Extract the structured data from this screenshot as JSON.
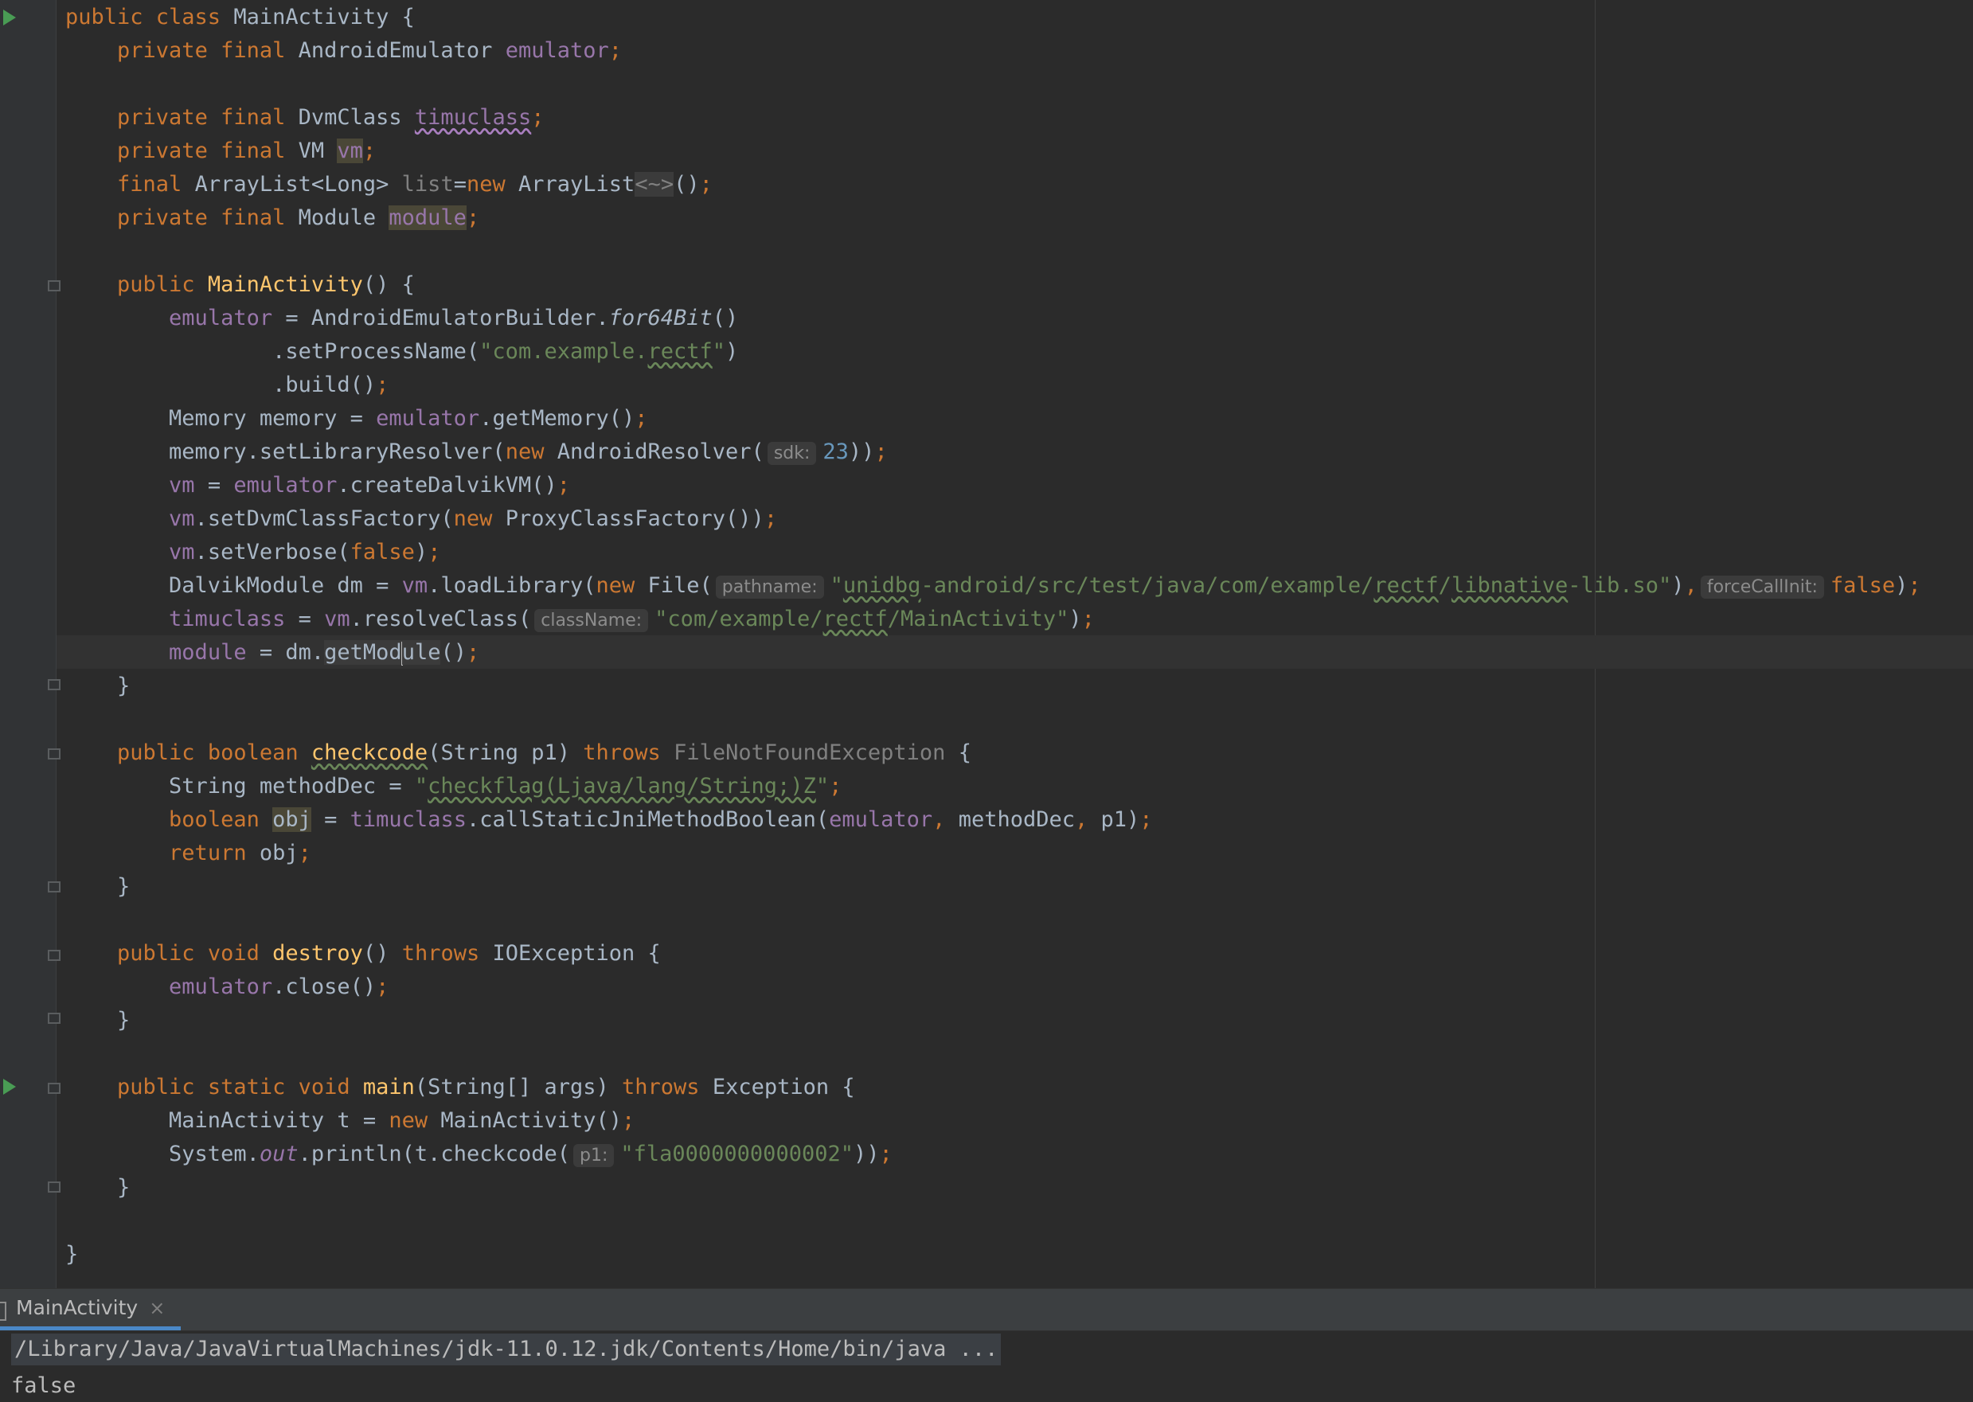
{
  "editor": {
    "lines": [
      [
        [
          "kw",
          "public class "
        ],
        [
          "",
          "MainActivity {"
        ]
      ],
      [
        [
          "",
          "    "
        ],
        [
          "kw",
          "private final "
        ],
        [
          "",
          "AndroidEmulator "
        ],
        [
          "fd",
          "emulator"
        ],
        [
          "kw",
          ";"
        ]
      ],
      [],
      [
        [
          "",
          "    "
        ],
        [
          "kw",
          "private final "
        ],
        [
          "",
          "DvmClass "
        ],
        [
          "fd sqp",
          "timuclass"
        ],
        [
          "kw",
          ";"
        ]
      ],
      [
        [
          "",
          "    "
        ],
        [
          "kw",
          "private final "
        ],
        [
          "",
          "VM "
        ],
        [
          "fd hl",
          "vm"
        ],
        [
          "kw",
          ";"
        ]
      ],
      [
        [
          "",
          "    "
        ],
        [
          "kw",
          "final "
        ],
        [
          "",
          "ArrayList<Long> "
        ],
        [
          "dim",
          "list"
        ],
        [
          "",
          "="
        ],
        [
          "kw",
          "new "
        ],
        [
          "",
          "ArrayList"
        ],
        [
          "dim hl2",
          "<~>"
        ],
        [
          "",
          "()"
        ],
        [
          "kw",
          ";"
        ]
      ],
      [
        [
          "",
          "    "
        ],
        [
          "kw",
          "private final "
        ],
        [
          "",
          "Module "
        ],
        [
          "fd hl",
          "module"
        ],
        [
          "kw",
          ";"
        ]
      ],
      [],
      [
        [
          "",
          "    "
        ],
        [
          "kw",
          "public "
        ],
        [
          "fn",
          "MainActivity"
        ],
        [
          "",
          "() {"
        ]
      ],
      [
        [
          "",
          "        "
        ],
        [
          "fd",
          "emulator"
        ],
        [
          "",
          " = AndroidEmulatorBuilder."
        ],
        [
          "it",
          "for64Bit"
        ],
        [
          "",
          "()"
        ]
      ],
      [
        [
          "",
          "                .setProcessName("
        ],
        [
          "st",
          "\"com.example."
        ],
        [
          "st sq",
          "rectf"
        ],
        [
          "st",
          "\""
        ],
        [
          "",
          ")"
        ]
      ],
      [
        [
          "",
          "                .build()"
        ],
        [
          "kw",
          ";"
        ]
      ],
      [
        [
          "",
          "        Memory memory = "
        ],
        [
          "fd",
          "emulator"
        ],
        [
          "",
          ".getMemory()"
        ],
        [
          "kw",
          ";"
        ]
      ],
      [
        [
          "",
          "        memory.setLibraryResolver("
        ],
        [
          "kw",
          "new "
        ],
        [
          "",
          "AndroidResolver("
        ],
        [
          "hint",
          "sdk:"
        ],
        [
          "nm",
          "23"
        ],
        [
          "",
          "))"
        ],
        [
          "kw",
          ";"
        ]
      ],
      [
        [
          "",
          "        "
        ],
        [
          "fd",
          "vm"
        ],
        [
          "",
          " = "
        ],
        [
          "fd",
          "emulator"
        ],
        [
          "",
          ".createDalvikVM()"
        ],
        [
          "kw",
          ";"
        ]
      ],
      [
        [
          "",
          "        "
        ],
        [
          "fd",
          "vm"
        ],
        [
          "",
          ".setDvmClassFactory("
        ],
        [
          "kw",
          "new "
        ],
        [
          "",
          "ProxyClassFactory())"
        ],
        [
          "kw",
          ";"
        ]
      ],
      [
        [
          "",
          "        "
        ],
        [
          "fd",
          "vm"
        ],
        [
          "",
          ".setVerbose("
        ],
        [
          "kw",
          "false"
        ],
        [
          "",
          ")"
        ],
        [
          "kw",
          ";"
        ]
      ],
      [
        [
          "",
          "        DalvikModule dm = "
        ],
        [
          "fd",
          "vm"
        ],
        [
          "",
          ".loadLibrary("
        ],
        [
          "kw",
          "new "
        ],
        [
          "",
          "File("
        ],
        [
          "hint",
          "pathname:"
        ],
        [
          "st",
          "\""
        ],
        [
          "st sq",
          "unidbg"
        ],
        [
          "st",
          "-android/src/test/java/com/example/"
        ],
        [
          "st sq",
          "rectf"
        ],
        [
          "st",
          "/"
        ],
        [
          "st sq",
          "libnative"
        ],
        [
          "st",
          "-lib.so\""
        ],
        [
          "",
          ")"
        ],
        [
          "kw",
          ","
        ],
        [
          "hint",
          "forceCallInit:"
        ],
        [
          "kw",
          "false"
        ],
        [
          "",
          ")"
        ],
        [
          "kw",
          ";"
        ]
      ],
      [
        [
          "",
          "        "
        ],
        [
          "fd",
          "timuclass"
        ],
        [
          "",
          " = "
        ],
        [
          "fd",
          "vm"
        ],
        [
          "",
          ".resolveClass("
        ],
        [
          "hint",
          "className:"
        ],
        [
          "st",
          "\"com/example/"
        ],
        [
          "st sq",
          "rectf"
        ],
        [
          "st",
          "/MainActivity\""
        ],
        [
          "",
          ")"
        ],
        [
          "kw",
          ";"
        ]
      ],
      [
        [
          "",
          "        "
        ],
        [
          "fd",
          "module"
        ],
        [
          "",
          " = dm."
        ],
        [
          "hl2",
          "getMod"
        ],
        [
          "caret",
          ""
        ],
        [
          "hl2",
          "ule"
        ],
        [
          "",
          "()"
        ],
        [
          "kw",
          ";"
        ]
      ],
      [
        [
          "",
          "    }"
        ]
      ],
      [],
      [
        [
          "",
          "    "
        ],
        [
          "kw",
          "public boolean "
        ],
        [
          "fn sq",
          "checkcode"
        ],
        [
          "",
          "(String p1) "
        ],
        [
          "kw",
          "throws "
        ],
        [
          "dim",
          "FileNotFoundException"
        ],
        [
          "",
          " {"
        ]
      ],
      [
        [
          "",
          "        String methodDec = "
        ],
        [
          "st",
          "\""
        ],
        [
          "st sq",
          "checkflag(Ljava/lang/String;)Z"
        ],
        [
          "st",
          "\""
        ],
        [
          "kw",
          ";"
        ]
      ],
      [
        [
          "",
          "        "
        ],
        [
          "kw",
          "boolean "
        ],
        [
          "hl",
          "obj"
        ],
        [
          "",
          " = "
        ],
        [
          "fd",
          "timuclass"
        ],
        [
          "",
          ".callStaticJniMethodBoolean("
        ],
        [
          "fd",
          "emulator"
        ],
        [
          "kw",
          ", "
        ],
        [
          "",
          "methodDec"
        ],
        [
          "kw",
          ", "
        ],
        [
          "",
          "p1)"
        ],
        [
          "kw",
          ";"
        ]
      ],
      [
        [
          "",
          "        "
        ],
        [
          "kw",
          "return "
        ],
        [
          "",
          "obj"
        ],
        [
          "kw",
          ";"
        ]
      ],
      [
        [
          "",
          "    }"
        ]
      ],
      [],
      [
        [
          "",
          "    "
        ],
        [
          "kw",
          "public void "
        ],
        [
          "fn",
          "destroy"
        ],
        [
          "",
          "() "
        ],
        [
          "kw",
          "throws "
        ],
        [
          "",
          "IOException {"
        ]
      ],
      [
        [
          "",
          "        "
        ],
        [
          "fd",
          "emulator"
        ],
        [
          "",
          ".close()"
        ],
        [
          "kw",
          ";"
        ]
      ],
      [
        [
          "",
          "    }"
        ]
      ],
      [],
      [
        [
          "",
          "    "
        ],
        [
          "kw",
          "public static void "
        ],
        [
          "fn",
          "main"
        ],
        [
          "",
          "(String[] args) "
        ],
        [
          "kw",
          "throws "
        ],
        [
          "",
          "Exception {"
        ]
      ],
      [
        [
          "",
          "        MainActivity t = "
        ],
        [
          "kw",
          "new "
        ],
        [
          "",
          "MainActivity()"
        ],
        [
          "kw",
          ";"
        ]
      ],
      [
        [
          "",
          "        System."
        ],
        [
          "fd it",
          "out"
        ],
        [
          "",
          ".println(t.checkcode("
        ],
        [
          "hint",
          "p1:"
        ],
        [
          "st",
          "\"fla0000000000002\""
        ],
        [
          "",
          "))"
        ],
        [
          "kw",
          ";"
        ]
      ],
      [
        [
          "",
          "    }"
        ]
      ],
      [],
      [
        [
          "",
          "}"
        ]
      ]
    ]
  },
  "run_panel": {
    "tab_label": "MainActivity",
    "tab_close": "×",
    "command": "/Library/Java/JavaVirtualMachines/jdk-11.0.12.jdk/Contents/Home/bin/java ...",
    "output": "false"
  }
}
